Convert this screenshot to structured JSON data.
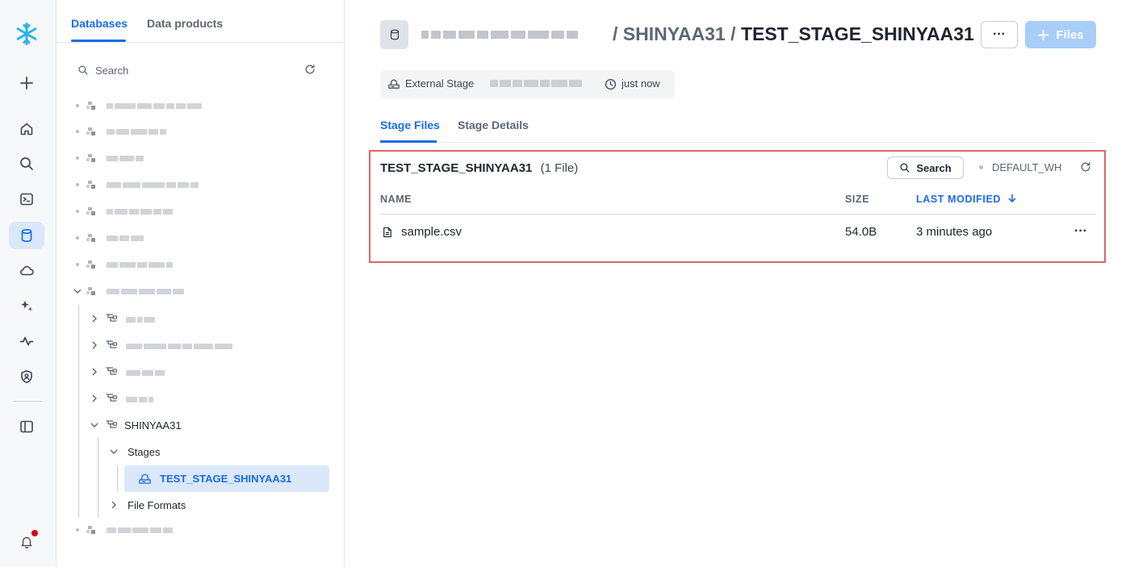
{
  "explorer": {
    "tabs": [
      "Databases",
      "Data products"
    ],
    "search_placeholder": "Search",
    "tree": {
      "schema": "SHINYAA31",
      "stages_folder": "Stages",
      "stage": "TEST_STAGE_SHINYAA31",
      "file_formats_folder": "File Formats"
    }
  },
  "header": {
    "breadcrumb_separator": "/",
    "schema": "SHINYAA31",
    "separator2": "/",
    "stage_name": "TEST_STAGE_SHINYAA31",
    "more_label": "···",
    "files_button": "Files"
  },
  "meta": {
    "stage_type": "External Stage",
    "updated": "just now"
  },
  "tabs": [
    "Stage Files",
    "Stage Details"
  ],
  "files_panel": {
    "title": "TEST_STAGE_SHINYAA31",
    "count": "(1 File)",
    "search_label": "Search",
    "warehouse": "DEFAULT_WH",
    "columns": {
      "name": "NAME",
      "size": "SIZE",
      "last_modified": "LAST MODIFIED"
    },
    "rows": [
      {
        "name": "sample.csv",
        "size": "54.0B",
        "last_modified": "3 minutes ago"
      }
    ]
  },
  "colors": {
    "accent": "#1a6ce7",
    "highlight_border": "#e06666",
    "selected_bg": "#dbe8fb",
    "files_button_bg": "#a8cdf7"
  }
}
